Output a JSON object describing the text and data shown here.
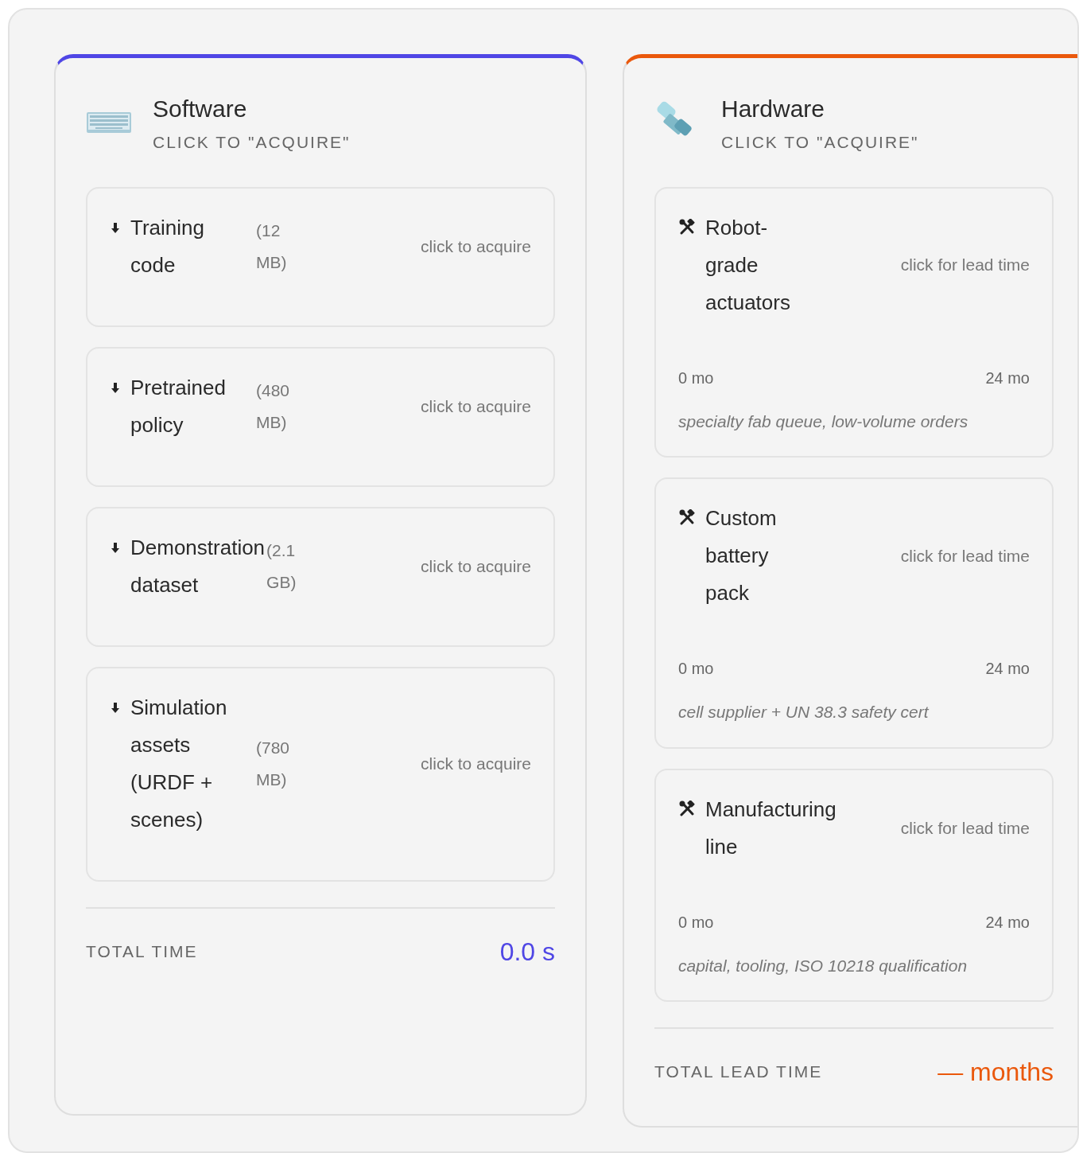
{
  "panels": [
    {
      "kind": "software",
      "title": "Software",
      "subtitle": "CLICK TO \"ACQUIRE\"",
      "color": "#4f46e5",
      "items": [
        {
          "name": "Training code",
          "size": "(12 MB)",
          "action": "click to acquire"
        },
        {
          "name": "Pretrained policy",
          "size": "(480 MB)",
          "action": "click to acquire"
        },
        {
          "name": "Demonstration dataset",
          "size": "(2.1 GB)",
          "action": "click to acquire"
        },
        {
          "name": "Simulation assets (URDF + scenes)",
          "size": "(780 MB)",
          "action": "click to acquire"
        }
      ],
      "total_label": "TOTAL TIME",
      "total_value": "0.0 s"
    },
    {
      "kind": "hardware",
      "title": "Hardware",
      "subtitle": "CLICK TO \"ACQUIRE\"",
      "color": "#ea580c",
      "items": [
        {
          "name": "Robot-grade actuators",
          "action": "click for lead time",
          "min": "0 mo",
          "max": "24 mo",
          "note": "specialty fab queue, low-volume orders"
        },
        {
          "name": "Custom battery pack",
          "action": "click for lead time",
          "min": "0 mo",
          "max": "24 mo",
          "note": "cell supplier + UN 38.3 safety cert"
        },
        {
          "name": "Manufacturing line",
          "action": "click for lead time",
          "min": "0 mo",
          "max": "24 mo",
          "note": "capital, tooling, ISO 10218 qualification"
        }
      ],
      "total_label": "TOTAL LEAD TIME",
      "total_value": "— months"
    }
  ]
}
